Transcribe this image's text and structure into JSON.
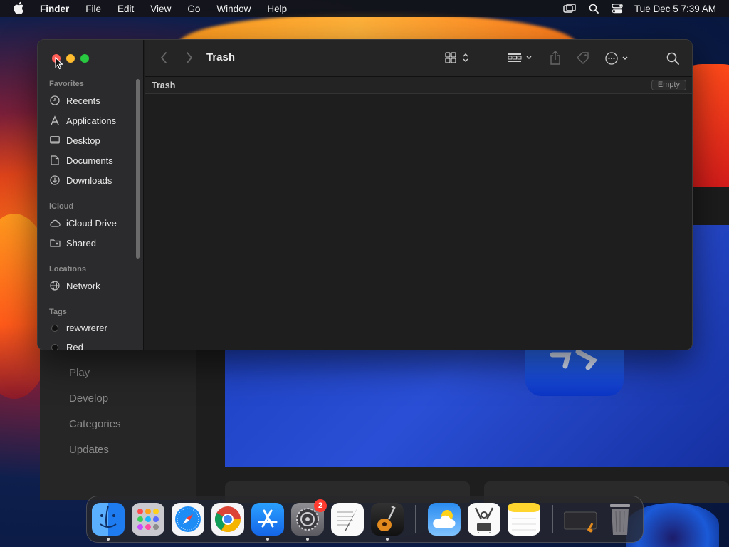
{
  "menubar": {
    "app_name": "Finder",
    "items": [
      "File",
      "Edit",
      "View",
      "Go",
      "Window",
      "Help"
    ],
    "clock": "Tue Dec 5  7:39 AM"
  },
  "finder": {
    "title": "Trash",
    "path_label": "Trash",
    "empty_button": "Empty",
    "sidebar": {
      "favorites_heading": "Favorites",
      "favorites": [
        "Recents",
        "Applications",
        "Desktop",
        "Documents",
        "Downloads"
      ],
      "icloud_heading": "iCloud",
      "icloud": [
        "iCloud Drive",
        "Shared"
      ],
      "locations_heading": "Locations",
      "locations": [
        "Network"
      ],
      "tags_heading": "Tags",
      "tags": [
        "rewwrerer",
        "Red"
      ]
    }
  },
  "background_app": {
    "nav": [
      "Play",
      "Develop",
      "Categories",
      "Updates"
    ]
  },
  "dock": {
    "settings_badge": "2",
    "apps": [
      "finder-icon",
      "launchpad-icon",
      "safari-icon",
      "chrome-icon",
      "app-store-icon",
      "system-settings-icon",
      "textedit-icon",
      "garageband-icon",
      "weather-icon",
      "system-info-icon",
      "notes-icon",
      "screen-recording-icon",
      "trash-icon"
    ]
  }
}
